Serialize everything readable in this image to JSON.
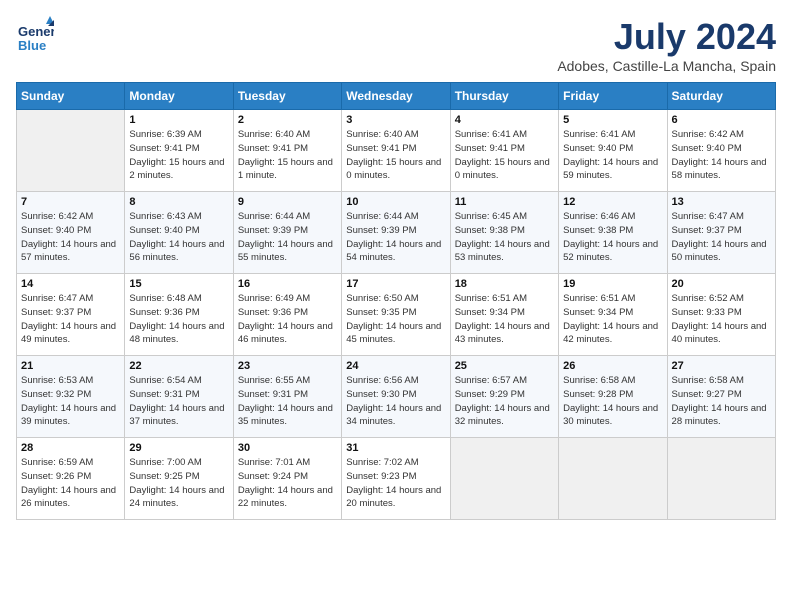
{
  "header": {
    "logo_line1": "General",
    "logo_line2": "Blue",
    "month_year": "July 2024",
    "location": "Adobes, Castille-La Mancha, Spain"
  },
  "weekdays": [
    "Sunday",
    "Monday",
    "Tuesday",
    "Wednesday",
    "Thursday",
    "Friday",
    "Saturday"
  ],
  "weeks": [
    [
      {
        "day": "",
        "sunrise": "",
        "sunset": "",
        "daylight": ""
      },
      {
        "day": "1",
        "sunrise": "Sunrise: 6:39 AM",
        "sunset": "Sunset: 9:41 PM",
        "daylight": "Daylight: 15 hours and 2 minutes."
      },
      {
        "day": "2",
        "sunrise": "Sunrise: 6:40 AM",
        "sunset": "Sunset: 9:41 PM",
        "daylight": "Daylight: 15 hours and 1 minute."
      },
      {
        "day": "3",
        "sunrise": "Sunrise: 6:40 AM",
        "sunset": "Sunset: 9:41 PM",
        "daylight": "Daylight: 15 hours and 0 minutes."
      },
      {
        "day": "4",
        "sunrise": "Sunrise: 6:41 AM",
        "sunset": "Sunset: 9:41 PM",
        "daylight": "Daylight: 15 hours and 0 minutes."
      },
      {
        "day": "5",
        "sunrise": "Sunrise: 6:41 AM",
        "sunset": "Sunset: 9:40 PM",
        "daylight": "Daylight: 14 hours and 59 minutes."
      },
      {
        "day": "6",
        "sunrise": "Sunrise: 6:42 AM",
        "sunset": "Sunset: 9:40 PM",
        "daylight": "Daylight: 14 hours and 58 minutes."
      }
    ],
    [
      {
        "day": "7",
        "sunrise": "Sunrise: 6:42 AM",
        "sunset": "Sunset: 9:40 PM",
        "daylight": "Daylight: 14 hours and 57 minutes."
      },
      {
        "day": "8",
        "sunrise": "Sunrise: 6:43 AM",
        "sunset": "Sunset: 9:40 PM",
        "daylight": "Daylight: 14 hours and 56 minutes."
      },
      {
        "day": "9",
        "sunrise": "Sunrise: 6:44 AM",
        "sunset": "Sunset: 9:39 PM",
        "daylight": "Daylight: 14 hours and 55 minutes."
      },
      {
        "day": "10",
        "sunrise": "Sunrise: 6:44 AM",
        "sunset": "Sunset: 9:39 PM",
        "daylight": "Daylight: 14 hours and 54 minutes."
      },
      {
        "day": "11",
        "sunrise": "Sunrise: 6:45 AM",
        "sunset": "Sunset: 9:38 PM",
        "daylight": "Daylight: 14 hours and 53 minutes."
      },
      {
        "day": "12",
        "sunrise": "Sunrise: 6:46 AM",
        "sunset": "Sunset: 9:38 PM",
        "daylight": "Daylight: 14 hours and 52 minutes."
      },
      {
        "day": "13",
        "sunrise": "Sunrise: 6:47 AM",
        "sunset": "Sunset: 9:37 PM",
        "daylight": "Daylight: 14 hours and 50 minutes."
      }
    ],
    [
      {
        "day": "14",
        "sunrise": "Sunrise: 6:47 AM",
        "sunset": "Sunset: 9:37 PM",
        "daylight": "Daylight: 14 hours and 49 minutes."
      },
      {
        "day": "15",
        "sunrise": "Sunrise: 6:48 AM",
        "sunset": "Sunset: 9:36 PM",
        "daylight": "Daylight: 14 hours and 48 minutes."
      },
      {
        "day": "16",
        "sunrise": "Sunrise: 6:49 AM",
        "sunset": "Sunset: 9:36 PM",
        "daylight": "Daylight: 14 hours and 46 minutes."
      },
      {
        "day": "17",
        "sunrise": "Sunrise: 6:50 AM",
        "sunset": "Sunset: 9:35 PM",
        "daylight": "Daylight: 14 hours and 45 minutes."
      },
      {
        "day": "18",
        "sunrise": "Sunrise: 6:51 AM",
        "sunset": "Sunset: 9:34 PM",
        "daylight": "Daylight: 14 hours and 43 minutes."
      },
      {
        "day": "19",
        "sunrise": "Sunrise: 6:51 AM",
        "sunset": "Sunset: 9:34 PM",
        "daylight": "Daylight: 14 hours and 42 minutes."
      },
      {
        "day": "20",
        "sunrise": "Sunrise: 6:52 AM",
        "sunset": "Sunset: 9:33 PM",
        "daylight": "Daylight: 14 hours and 40 minutes."
      }
    ],
    [
      {
        "day": "21",
        "sunrise": "Sunrise: 6:53 AM",
        "sunset": "Sunset: 9:32 PM",
        "daylight": "Daylight: 14 hours and 39 minutes."
      },
      {
        "day": "22",
        "sunrise": "Sunrise: 6:54 AM",
        "sunset": "Sunset: 9:31 PM",
        "daylight": "Daylight: 14 hours and 37 minutes."
      },
      {
        "day": "23",
        "sunrise": "Sunrise: 6:55 AM",
        "sunset": "Sunset: 9:31 PM",
        "daylight": "Daylight: 14 hours and 35 minutes."
      },
      {
        "day": "24",
        "sunrise": "Sunrise: 6:56 AM",
        "sunset": "Sunset: 9:30 PM",
        "daylight": "Daylight: 14 hours and 34 minutes."
      },
      {
        "day": "25",
        "sunrise": "Sunrise: 6:57 AM",
        "sunset": "Sunset: 9:29 PM",
        "daylight": "Daylight: 14 hours and 32 minutes."
      },
      {
        "day": "26",
        "sunrise": "Sunrise: 6:58 AM",
        "sunset": "Sunset: 9:28 PM",
        "daylight": "Daylight: 14 hours and 30 minutes."
      },
      {
        "day": "27",
        "sunrise": "Sunrise: 6:58 AM",
        "sunset": "Sunset: 9:27 PM",
        "daylight": "Daylight: 14 hours and 28 minutes."
      }
    ],
    [
      {
        "day": "28",
        "sunrise": "Sunrise: 6:59 AM",
        "sunset": "Sunset: 9:26 PM",
        "daylight": "Daylight: 14 hours and 26 minutes."
      },
      {
        "day": "29",
        "sunrise": "Sunrise: 7:00 AM",
        "sunset": "Sunset: 9:25 PM",
        "daylight": "Daylight: 14 hours and 24 minutes."
      },
      {
        "day": "30",
        "sunrise": "Sunrise: 7:01 AM",
        "sunset": "Sunset: 9:24 PM",
        "daylight": "Daylight: 14 hours and 22 minutes."
      },
      {
        "day": "31",
        "sunrise": "Sunrise: 7:02 AM",
        "sunset": "Sunset: 9:23 PM",
        "daylight": "Daylight: 14 hours and 20 minutes."
      },
      {
        "day": "",
        "sunrise": "",
        "sunset": "",
        "daylight": ""
      },
      {
        "day": "",
        "sunrise": "",
        "sunset": "",
        "daylight": ""
      },
      {
        "day": "",
        "sunrise": "",
        "sunset": "",
        "daylight": ""
      }
    ]
  ]
}
